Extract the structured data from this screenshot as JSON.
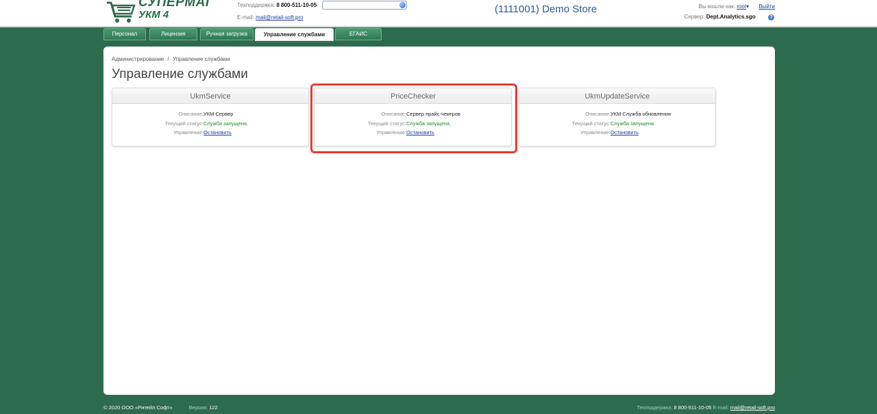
{
  "header": {
    "logo_line1": "СУПЕРМАГ",
    "logo_line2": "УКМ 4",
    "support_label": "Техподдержка:",
    "support_phone": "8 800-511-10-05",
    "email_label": "E-mail:",
    "email": "mail@retail-soft.pro",
    "store": "(1111001) Demo Store",
    "logged_in_label": "Вы вошли как:",
    "user": "root",
    "user_dropdown_icon": "▾",
    "logout": "Выйти",
    "server_label": "Сервер:",
    "server": "Dept.Analytics.sgo",
    "help_icon": "?"
  },
  "tabs": [
    {
      "label": "Персонал"
    },
    {
      "label": "Лицензия"
    },
    {
      "label": "Ручная загрузка"
    },
    {
      "label": "Управление службами",
      "active": true
    },
    {
      "label": "ЕГАИС"
    }
  ],
  "breadcrumb": {
    "root": "Администрирование",
    "sep": "/",
    "current": "Управление службами"
  },
  "page_title": "Управление службами",
  "services": [
    {
      "name": "UkmService",
      "desc_label": "Описание:",
      "desc": "УКМ Сервер",
      "status_label": "Текущий статус:",
      "status": "Служба запущена.",
      "control_label": "Управление:",
      "control": "Остановить"
    },
    {
      "name": "PriceChecker",
      "desc_label": "Описание:",
      "desc": "Сервер прайс-чекеров",
      "status_label": "Текущий статус:",
      "status": "Служба запущена.",
      "control_label": "Управление:",
      "control": "Остановить"
    },
    {
      "name": "UkmUpdateService",
      "desc_label": "Описание:",
      "desc": "УКМ Служба обновления",
      "status_label": "Текущий статус:",
      "status": "Служба запущена.",
      "control_label": "Управление:",
      "control": "Остановить"
    }
  ],
  "footer": {
    "copyright": "© 2020 ООО «Ритейл Софт»",
    "version_label": "Версия:",
    "version": "122",
    "support_label": "Техподдержка:",
    "support_phone": "8 800-511-10-05",
    "email_label": "E-mail:",
    "email": "mail@retail-soft.pro"
  },
  "colors": {
    "background": "#2d6b4e",
    "tab": "#3a8a60",
    "status_ok": "#1f8a1f",
    "highlight": "#e23b34",
    "link": "#1b3fa0"
  }
}
